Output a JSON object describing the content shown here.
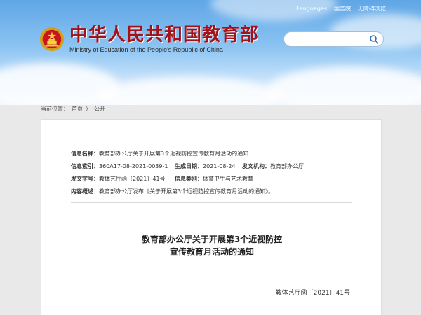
{
  "header": {
    "title_cn": "中华人民共和国教育部",
    "title_en": "Ministry of Education of the People's Republic of China",
    "topnav": [
      {
        "label": "Languages"
      },
      {
        "label": "国务院"
      },
      {
        "label": "无障碍浏览"
      }
    ],
    "search": {
      "placeholder": ""
    }
  },
  "breadcrumb": {
    "label": "当前位置：",
    "items": [
      "首页",
      "公开"
    ],
    "separator": "〉"
  },
  "meta": {
    "info_name_label": "信息名称：",
    "info_name_value": "教育部办公厅关于开展第3个近视防控宣传教育月活动的通知",
    "index_label": "信息索引：",
    "index_value": "360A17-08-2021-0039-1",
    "date_label": "生成日期：",
    "date_value": "2021-08-24",
    "issuer_label": "发文机构：",
    "issuer_value": "教育部办公厅",
    "doc_no_label": "发文字号：",
    "doc_no_value": "教体艺厅函〔2021〕41号",
    "category_label": "信息类别：",
    "category_value": "体育卫生与艺术教育",
    "summary_label": "内容概述：",
    "summary_value": "教育部办公厅发布《关于开展第3个近视防控宣传教育月活动的通知》。"
  },
  "document": {
    "title_line1": "教育部办公厅关于开展第3个近视防控",
    "title_line2": "宣传教育月活动的通知",
    "doc_number": "教体艺厅函〔2021〕41号"
  },
  "colors": {
    "brand_red": "#a3121a",
    "sky": "#5fa6e6"
  }
}
